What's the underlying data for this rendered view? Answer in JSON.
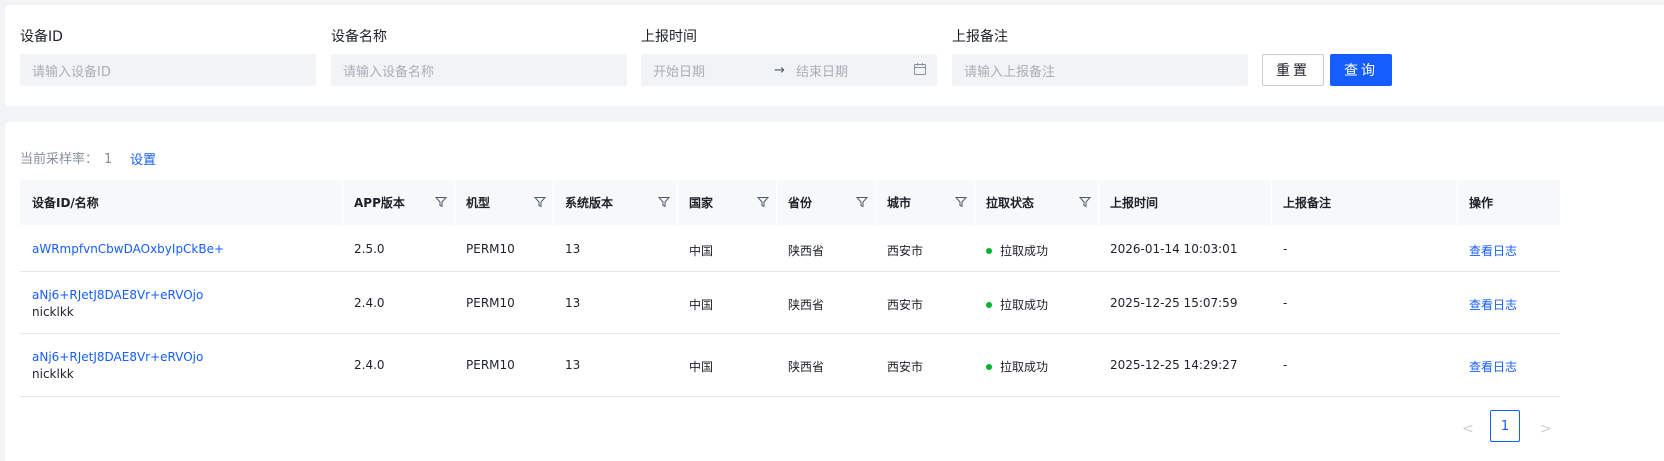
{
  "filters": {
    "device_id": {
      "label": "设备ID",
      "placeholder": "请输入设备ID"
    },
    "device_name": {
      "label": "设备名称",
      "placeholder": "请输入设备名称"
    },
    "report_time": {
      "label": "上报时间",
      "start_placeholder": "开始日期",
      "end_placeholder": "结束日期",
      "separator": "→",
      "icon": "calendar-icon"
    },
    "report_note": {
      "label": "上报备注",
      "placeholder": "请输入上报备注"
    },
    "reset_label": "重置",
    "query_label": "查询"
  },
  "sampling": {
    "label": "当前采样率：",
    "value": "1",
    "set_label": "设置"
  },
  "table": {
    "columns": [
      {
        "label": "设备ID/名称",
        "filter": false
      },
      {
        "label": "APP版本",
        "filter": true
      },
      {
        "label": "机型",
        "filter": true
      },
      {
        "label": "系统版本",
        "filter": true
      },
      {
        "label": "国家",
        "filter": true
      },
      {
        "label": "省份",
        "filter": true
      },
      {
        "label": "城市",
        "filter": true
      },
      {
        "label": "拉取状态",
        "filter": true
      },
      {
        "label": "上报时间",
        "filter": false
      },
      {
        "label": "上报备注",
        "filter": false
      },
      {
        "label": "操作",
        "filter": false
      }
    ],
    "rows": [
      {
        "device_id": "aWRmpfvnCbwDAOxbyIpCkBe+",
        "device_name": "",
        "app_version": "2.5.0",
        "model": "PERM10",
        "os_version": "13",
        "country": "中国",
        "province": "陕西省",
        "city": "西安市",
        "status": "拉取成功",
        "report_time": "2026-01-14 10:03:01",
        "note": "-",
        "action": "查看日志"
      },
      {
        "device_id": "aNj6+RJetJ8DAE8Vr+eRVOjo",
        "device_name": "nicklkk",
        "app_version": "2.4.0",
        "model": "PERM10",
        "os_version": "13",
        "country": "中国",
        "province": "陕西省",
        "city": "西安市",
        "status": "拉取成功",
        "report_time": "2025-12-25 15:07:59",
        "note": "-",
        "action": "查看日志"
      },
      {
        "device_id": "aNj6+RJetJ8DAE8Vr+eRVOjo",
        "device_name": "nicklkk",
        "app_version": "2.4.0",
        "model": "PERM10",
        "os_version": "13",
        "country": "中国",
        "province": "陕西省",
        "city": "西安市",
        "status": "拉取成功",
        "report_time": "2025-12-25 14:29:27",
        "note": "-",
        "action": "查看日志"
      }
    ]
  },
  "pagination": {
    "prev": "<",
    "current": "1",
    "next": ">"
  },
  "colors": {
    "primary": "#165dff",
    "success": "#00b42a",
    "page_bg": "#f2f3f5"
  }
}
